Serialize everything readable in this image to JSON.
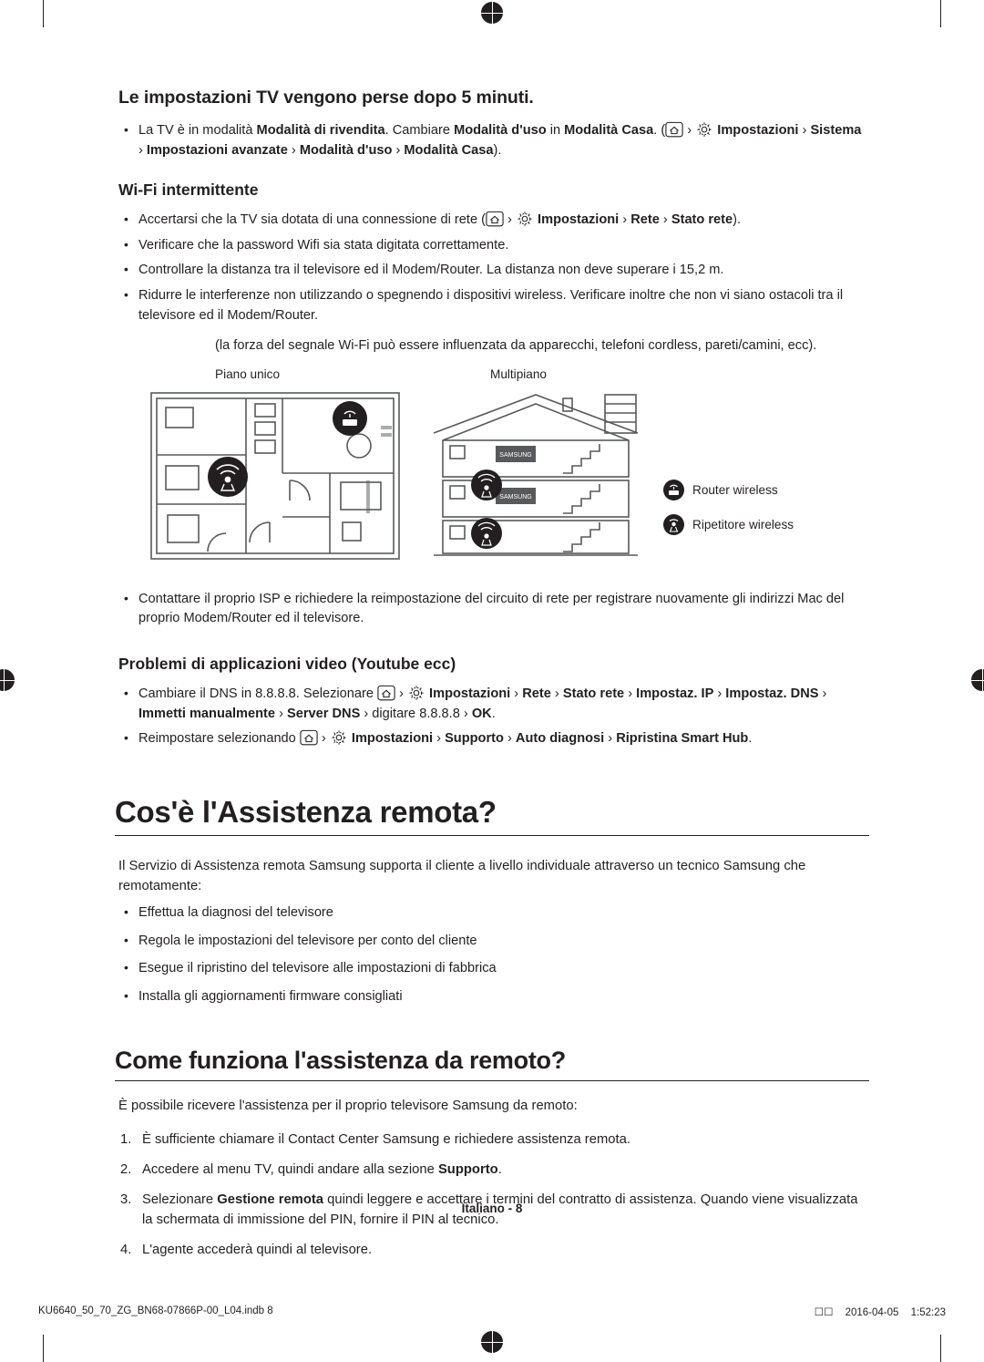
{
  "document": {
    "page_label": "Italiano - 8",
    "footer_left": "KU6640_50_70_ZG_BN68-07866P-00_L04.indb   8",
    "footer_right_date": "2016-04-05",
    "footer_right_time": "1:52:23",
    "footer_right_icons": "☐☐"
  },
  "sections": {
    "lost_settings": {
      "heading": "Le impostazioni TV vengono perse dopo 5 minuti.",
      "bullets": [
        {
          "parts": [
            {
              "t": "La TV è in modalità "
            },
            {
              "t": "Modalità di rivendita",
              "b": true
            },
            {
              "t": ". Cambiare "
            },
            {
              "t": "Modalità d'uso",
              "b": true
            },
            {
              "t": " in "
            },
            {
              "t": "Modalità Casa",
              "b": true
            },
            {
              "t": ". ("
            },
            {
              "icon": "home-icon"
            },
            {
              "t": " › "
            },
            {
              "icon": "gear-icon"
            },
            {
              "t": " Impostazioni",
              "b": true
            },
            {
              "t": " › "
            },
            {
              "t": "Sistema",
              "b": true
            },
            {
              "t": " › "
            },
            {
              "t": "Impostazioni avanzate",
              "b": true
            },
            {
              "t": " › "
            },
            {
              "t": "Modalità d'uso",
              "b": true
            },
            {
              "t": " › "
            },
            {
              "t": "Modalità Casa",
              "b": true
            },
            {
              "t": ")."
            }
          ]
        }
      ]
    },
    "wifi": {
      "heading": "Wi-Fi intermittente",
      "bullets": [
        {
          "parts": [
            {
              "t": "Accertarsi che la TV sia dotata di una connessione di rete ("
            },
            {
              "icon": "home-icon"
            },
            {
              "t": " › "
            },
            {
              "icon": "gear-icon"
            },
            {
              "t": " Impostazioni",
              "b": true
            },
            {
              "t": " › "
            },
            {
              "t": "Rete",
              "b": true
            },
            {
              "t": " › "
            },
            {
              "t": "Stato rete",
              "b": true
            },
            {
              "t": ")."
            }
          ]
        },
        {
          "parts": [
            {
              "t": "Verificare che la password Wifi sia stata digitata correttamente."
            }
          ]
        },
        {
          "parts": [
            {
              "t": "Controllare la distanza tra il televisore ed il Modem/Router. La distanza non deve superare i 15,2 m."
            }
          ]
        },
        {
          "parts": [
            {
              "t": "Ridurre le interferenze non utilizzando o spegnendo i dispositivi wireless. Verificare inoltre che non vi siano ostacoli tra il televisore ed il Modem/Router."
            }
          ]
        },
        {
          "nobullet": true,
          "parts": [
            {
              "t": "(la forza del segnale Wi-Fi può essere influenzata da apparecchi, telefoni cordless, pareti/camini, ecc)."
            }
          ]
        }
      ],
      "figure": {
        "caption_left": "Piano unico",
        "caption_right": "Multipiano",
        "legend": [
          {
            "label": "Router wireless",
            "icon": "wireless-router-icon"
          },
          {
            "label": "Ripetitore wireless",
            "icon": "wireless-repeater-icon"
          }
        ],
        "tv_brand": "SAMSUNG"
      },
      "bullets_after": [
        {
          "parts": [
            {
              "t": "Contattare il proprio ISP e richiedere la reimpostazione del circuito di rete per registrare nuovamente gli indirizzi Mac del proprio Modem/Router ed il televisore."
            }
          ]
        }
      ]
    },
    "video_apps": {
      "heading": "Problemi di applicazioni video (Youtube ecc)",
      "bullets": [
        {
          "parts": [
            {
              "t": "Cambiare il DNS in 8.8.8.8. Selezionare "
            },
            {
              "icon": "home-icon"
            },
            {
              "t": " › "
            },
            {
              "icon": "gear-icon"
            },
            {
              "t": " Impostazioni",
              "b": true
            },
            {
              "t": " › "
            },
            {
              "t": "Rete",
              "b": true
            },
            {
              "t": " › "
            },
            {
              "t": "Stato rete",
              "b": true
            },
            {
              "t": " › "
            },
            {
              "t": "Impostaz. IP",
              "b": true
            },
            {
              "t": " › "
            },
            {
              "t": "Impostaz. DNS",
              "b": true
            },
            {
              "t": " › "
            },
            {
              "t": "Immetti manualmente",
              "b": true
            },
            {
              "t": " › "
            },
            {
              "t": "Server DNS",
              "b": true
            },
            {
              "t": " › digitare 8.8.8.8 › "
            },
            {
              "t": "OK",
              "b": true
            },
            {
              "t": "."
            }
          ]
        },
        {
          "parts": [
            {
              "t": "Reimpostare selezionando "
            },
            {
              "icon": "home-icon"
            },
            {
              "t": " › "
            },
            {
              "icon": "gear-icon"
            },
            {
              "t": " Impostazioni",
              "b": true
            },
            {
              "t": " › "
            },
            {
              "t": "Supporto",
              "b": true
            },
            {
              "t": " › "
            },
            {
              "t": "Auto diagnosi",
              "b": true
            },
            {
              "t": " › "
            },
            {
              "t": "Ripristina Smart Hub",
              "b": true
            },
            {
              "t": "."
            }
          ]
        }
      ]
    },
    "remote_assistance": {
      "heading": "Cos'è l'Assistenza remota?",
      "intro": "Il Servizio di Assistenza remota Samsung supporta il cliente a livello individuale attraverso un tecnico Samsung che remotamente:",
      "bullets": [
        {
          "parts": [
            {
              "t": "Effettua la diagnosi del televisore"
            }
          ]
        },
        {
          "parts": [
            {
              "t": "Regola le impostazioni del televisore per conto del cliente"
            }
          ]
        },
        {
          "parts": [
            {
              "t": "Esegue il ripristino del televisore alle impostazioni di fabbrica"
            }
          ]
        },
        {
          "parts": [
            {
              "t": "Installa gli aggiornamenti firmware consigliati"
            }
          ]
        }
      ]
    },
    "how_remote_works": {
      "heading": "Come funziona l'assistenza da remoto?",
      "intro": "È possibile ricevere l'assistenza per il proprio televisore Samsung da remoto:",
      "steps": [
        {
          "parts": [
            {
              "t": "È sufficiente chiamare il Contact Center Samsung e richiedere assistenza remota."
            }
          ]
        },
        {
          "parts": [
            {
              "t": "Accedere al menu TV, quindi andare alla sezione "
            },
            {
              "t": "Supporto",
              "b": true
            },
            {
              "t": "."
            }
          ]
        },
        {
          "parts": [
            {
              "t": "Selezionare "
            },
            {
              "t": "Gestione remota",
              "b": true
            },
            {
              "t": " quindi leggere e accettare i termini del contratto di assistenza. Quando viene visualizzata la schermata di immissione del PIN, fornire il PIN al tecnico."
            }
          ]
        },
        {
          "parts": [
            {
              "t": "L'agente accederà quindi al televisore."
            }
          ]
        }
      ]
    }
  }
}
